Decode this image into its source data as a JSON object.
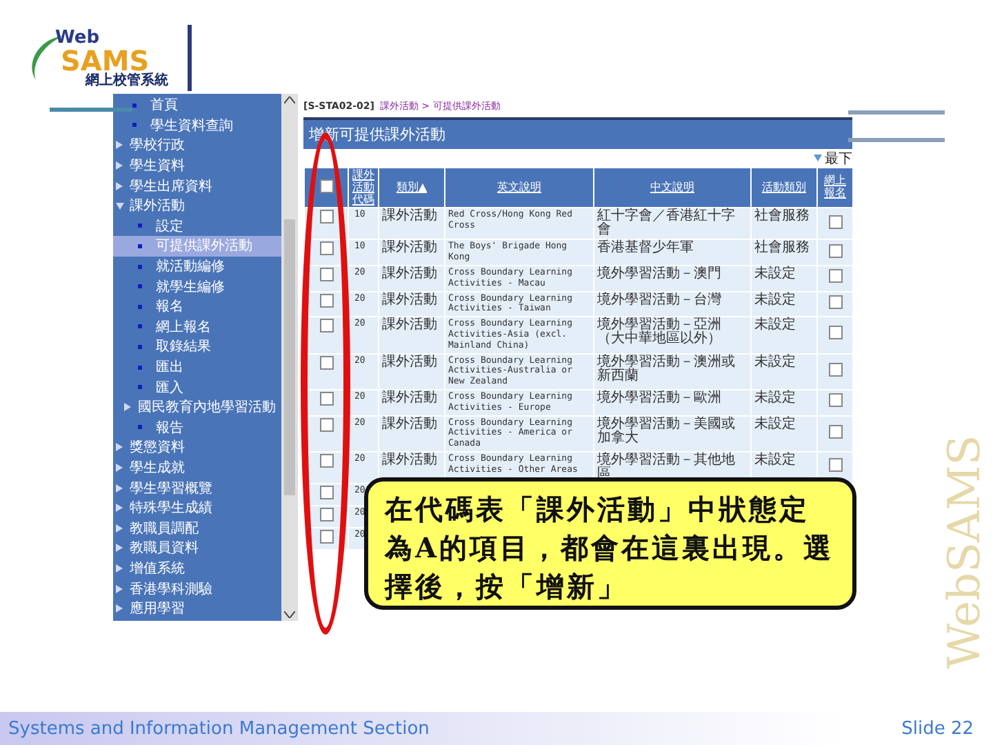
{
  "logo": {
    "word": "Web",
    "brand": "SAMS",
    "subtitle": "網上校管系統"
  },
  "sidebar": {
    "items": [
      {
        "label": "首頁",
        "kind": "bullet",
        "selected": false
      },
      {
        "label": "學生資料查詢",
        "kind": "bullet",
        "selected": false
      },
      {
        "label": "學校行政",
        "kind": "arrow",
        "selected": false
      },
      {
        "label": "學生資料",
        "kind": "arrow",
        "selected": false
      },
      {
        "label": "學生出席資料",
        "kind": "arrow",
        "selected": false
      },
      {
        "label": "課外活動",
        "kind": "folder",
        "selected": false,
        "expanded": true,
        "children": [
          {
            "label": "設定",
            "kind": "bullet",
            "selected": false
          },
          {
            "label": "可提供課外活動",
            "kind": "bullet",
            "selected": true
          },
          {
            "label": "就活動編修",
            "kind": "bullet",
            "selected": false
          },
          {
            "label": "就學生編修",
            "kind": "bullet",
            "selected": false
          },
          {
            "label": "報名",
            "kind": "bullet",
            "selected": false
          },
          {
            "label": "網上報名",
            "kind": "bullet",
            "selected": false
          },
          {
            "label": "取錄結果",
            "kind": "bullet",
            "selected": false
          },
          {
            "label": "匯出",
            "kind": "bullet",
            "selected": false
          },
          {
            "label": "匯入",
            "kind": "bullet",
            "selected": false
          },
          {
            "label": "國民教育內地學習活動",
            "kind": "arrow",
            "selected": false
          },
          {
            "label": "報告",
            "kind": "bullet",
            "selected": false
          }
        ]
      },
      {
        "label": "獎懲資料",
        "kind": "arrow",
        "selected": false
      },
      {
        "label": "學生成就",
        "kind": "arrow",
        "selected": false
      },
      {
        "label": "學生學習概覽",
        "kind": "arrow",
        "selected": false
      },
      {
        "label": "特殊學生成績",
        "kind": "arrow",
        "selected": false
      },
      {
        "label": "教職員調配",
        "kind": "arrow",
        "selected": false
      },
      {
        "label": "教職員資料",
        "kind": "arrow",
        "selected": false
      },
      {
        "label": "增值系統",
        "kind": "arrow",
        "selected": false
      },
      {
        "label": "香港學科測驗",
        "kind": "arrow",
        "selected": false
      },
      {
        "label": "應用學習",
        "kind": "arrow",
        "selected": false
      }
    ]
  },
  "page": {
    "code": "[S-STA02-02]",
    "breadcrumb": "課外活動 > 可提供課外活動",
    "title": "增新可提供課外活動",
    "jump": "最下"
  },
  "table": {
    "select_all": false,
    "columns": [
      "課外活動代碼",
      "類別▲",
      "英文說明",
      "中文說明",
      "活動類別",
      "網上報名"
    ],
    "rows": [
      {
        "checked": false,
        "code": "10",
        "category": "課外活動",
        "english": "Red Cross/Hong Kong Red Cross",
        "chinese": "紅十字會／香港紅十字會",
        "type": "社會服務",
        "online": false
      },
      {
        "checked": false,
        "code": "10",
        "category": "課外活動",
        "english": "The Boys' Brigade Hong Kong",
        "chinese": "香港基督少年軍",
        "type": "社會服務",
        "online": false
      },
      {
        "checked": false,
        "code": "20",
        "category": "課外活動",
        "english": "Cross Boundary Learning Activities - Macau",
        "chinese": "境外學習活動－澳門",
        "type": "未設定",
        "online": false
      },
      {
        "checked": false,
        "code": "20",
        "category": "課外活動",
        "english": "Cross Boundary Learning Activities - Taiwan",
        "chinese": "境外學習活動－台灣",
        "type": "未設定",
        "online": false
      },
      {
        "checked": false,
        "code": "20",
        "category": "課外活動",
        "english": "Cross Boundary Learning Activities-Asia (excl. Mainland China)",
        "chinese": "境外學習活動－亞洲（大中華地區以外）",
        "type": "未設定",
        "online": false
      },
      {
        "checked": false,
        "code": "20",
        "category": "課外活動",
        "english": "Cross Boundary Learning Activities-Australia or New Zealand",
        "chinese": "境外學習活動－澳洲或新西蘭",
        "type": "未設定",
        "online": false
      },
      {
        "checked": false,
        "code": "20",
        "category": "課外活動",
        "english": "Cross Boundary Learning Activities - Europe",
        "chinese": "境外學習活動－歐洲",
        "type": "未設定",
        "online": false
      },
      {
        "checked": false,
        "code": "20",
        "category": "課外活動",
        "english": "Cross Boundary Learning Activities - America or Canada",
        "chinese": "境外學習活動－美國或加拿大",
        "type": "未設定",
        "online": false
      },
      {
        "checked": false,
        "code": "20",
        "category": "課外活動",
        "english": "Cross Boundary Learning Activities - Other Areas",
        "chinese": "境外學習活動－其他地區",
        "type": "未設定",
        "online": false
      },
      {
        "checked": false,
        "code": "20"
      },
      {
        "checked": false,
        "code": "20"
      },
      {
        "checked": false,
        "code": "20"
      }
    ]
  },
  "callout": "在代碼表「課外活動」中狀態定為A的項目，都會在這裏出現。選擇後，按「增新」",
  "footer": {
    "left": "Systems and Information Management Section",
    "right": "Slide 22"
  },
  "decoration": "WebSAMS"
}
